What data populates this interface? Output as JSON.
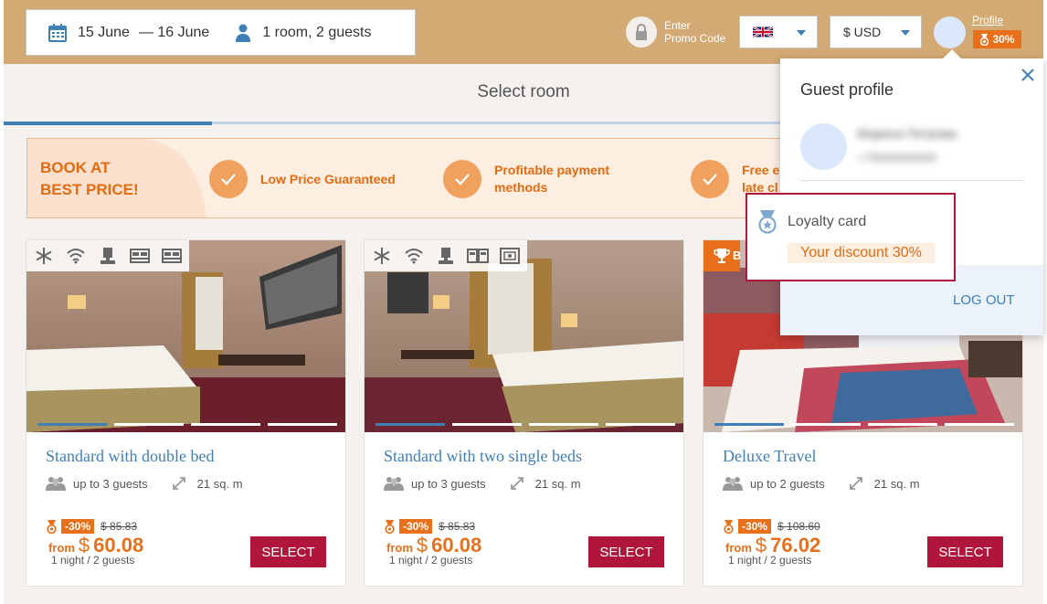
{
  "header": {
    "date_from": "15 June",
    "date_to": "— 16 June",
    "guests": "1 room, 2 guests",
    "promo_line1": "Enter",
    "promo_line2": "Promo Code",
    "language_flag": "uk-flag",
    "currency": "$ USD",
    "profile_label": "Profile",
    "profile_discount": "30%"
  },
  "page": {
    "title": "Select room"
  },
  "banner": {
    "title_line1": "BOOK AT",
    "title_line2": "BEST PRICE!",
    "features": [
      {
        "line1": "Low Price Guaranteed",
        "line2": ""
      },
      {
        "line1": "Profitable payment",
        "line2": "methods"
      },
      {
        "line1": "Free e",
        "line2": "late cl"
      }
    ]
  },
  "rooms": [
    {
      "name": "Standard with double bed",
      "guests": "up to 3 guests",
      "area": "21 sq. m",
      "discount": "-30%",
      "old_price": "$ 85.83",
      "from": "from",
      "currency": "$",
      "price": "60.08",
      "nights": "1 night / 2 guests",
      "select": "SELECT",
      "amenities": [
        "snowflake-icon",
        "wifi-icon",
        "kettle-icon",
        "double-bed-icon",
        "double-bed-icon"
      ]
    },
    {
      "name": "Standard with two single beds",
      "guests": "up to 3 guests",
      "area": "21 sq. m",
      "discount": "-30%",
      "old_price": "$ 85.83",
      "from": "from",
      "currency": "$",
      "price": "60.08",
      "nights": "1 night / 2 guests",
      "select": "SELECT",
      "amenities": [
        "snowflake-icon",
        "wifi-icon",
        "kettle-icon",
        "single-beds-icon",
        "safe-icon"
      ]
    },
    {
      "name": "Deluxe Travel",
      "badge": "B",
      "guests": "up to 2 guests",
      "area": "21 sq. m",
      "discount": "-30%",
      "old_price": "$ 108.60",
      "from": "from",
      "currency": "$",
      "price": "76.02",
      "nights": "1 night / 2 guests",
      "select": "SELECT"
    }
  ],
  "profile_dropdown": {
    "title": "Guest profile",
    "name": "Марина Петрова",
    "phone": "+79999999999",
    "loyalty_title": "Loyalty card",
    "loyalty_discount": "Your discount 30%",
    "logout": "LOG OUT"
  },
  "colors": {
    "topbar": "#d3aa73",
    "accent_orange": "#e8701a",
    "link_blue": "#3f7fb5",
    "select_red": "#b0163b",
    "banner_bg": "#fdeee2"
  }
}
